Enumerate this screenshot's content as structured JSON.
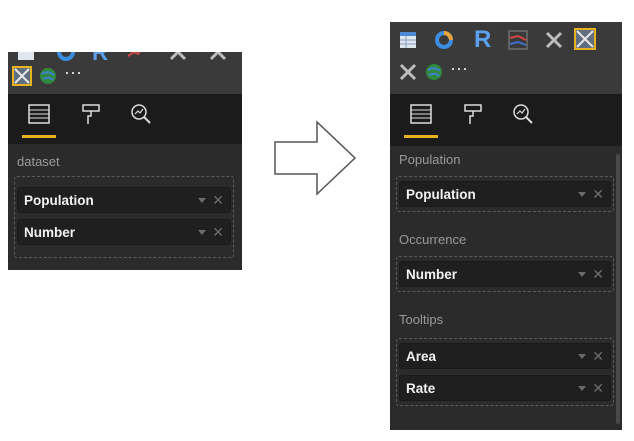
{
  "icons": {
    "left_icons": [
      "table-icon",
      "donut-chart-icon",
      "r-visual-icon",
      "line-chart-icon",
      "tools-icon",
      "tools-icon",
      "custom-visual-icon",
      "globe-icon",
      "more-icon"
    ],
    "right_icons": [
      "table-icon",
      "donut-chart-icon",
      "r-visual-icon",
      "line-chart-icon",
      "tools-icon",
      "custom-visual-icon",
      "tools-icon",
      "globe-icon",
      "more-icon"
    ],
    "more_label": "···",
    "r_label": "R"
  },
  "tabs": [
    "fields-tab",
    "format-tab",
    "analytics-tab"
  ],
  "left_panel": {
    "section_label": "dataset",
    "fields": [
      "Population",
      "Number"
    ]
  },
  "right_panel": {
    "sections": [
      {
        "label": "Population",
        "fields": [
          "Population"
        ]
      },
      {
        "label": "Occurrence",
        "fields": [
          "Number"
        ]
      },
      {
        "label": "Tooltips",
        "fields": [
          "Area",
          "Rate"
        ]
      }
    ]
  },
  "field_remove_label": "✕",
  "colors": {
    "panel_bg": "#2b2b2b",
    "tab_bar_bg": "#1b1b1b",
    "accent": "#e6b31e",
    "field_bg": "#1f1f1f",
    "label_gray": "#9a9a9a"
  }
}
